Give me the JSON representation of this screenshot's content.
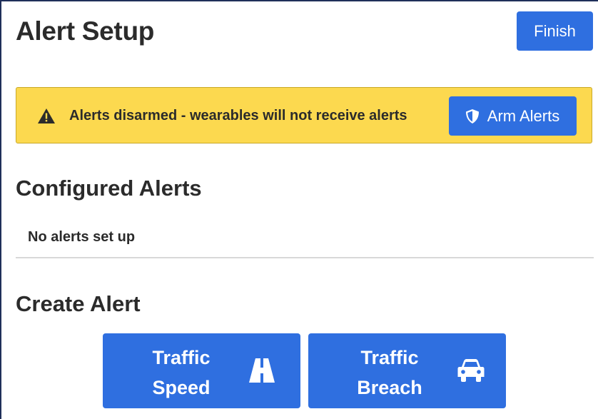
{
  "header": {
    "title": "Alert Setup",
    "finish_label": "Finish"
  },
  "banner": {
    "message": "Alerts disarmed - wearables will not receive alerts",
    "arm_label": "Arm Alerts",
    "icon": "warning-triangle-icon",
    "button_icon": "shield-icon",
    "background": "#fcd94f"
  },
  "configured": {
    "title": "Configured Alerts",
    "empty_message": "No alerts set up"
  },
  "create": {
    "title": "Create Alert",
    "tiles": [
      {
        "line1": "Traffic",
        "line2": "Speed",
        "icon": "road-icon"
      },
      {
        "line1": "Traffic",
        "line2": "Breach",
        "icon": "car-icon"
      }
    ]
  },
  "colors": {
    "accent": "#2f6fe0",
    "text": "#2b2b2b"
  }
}
